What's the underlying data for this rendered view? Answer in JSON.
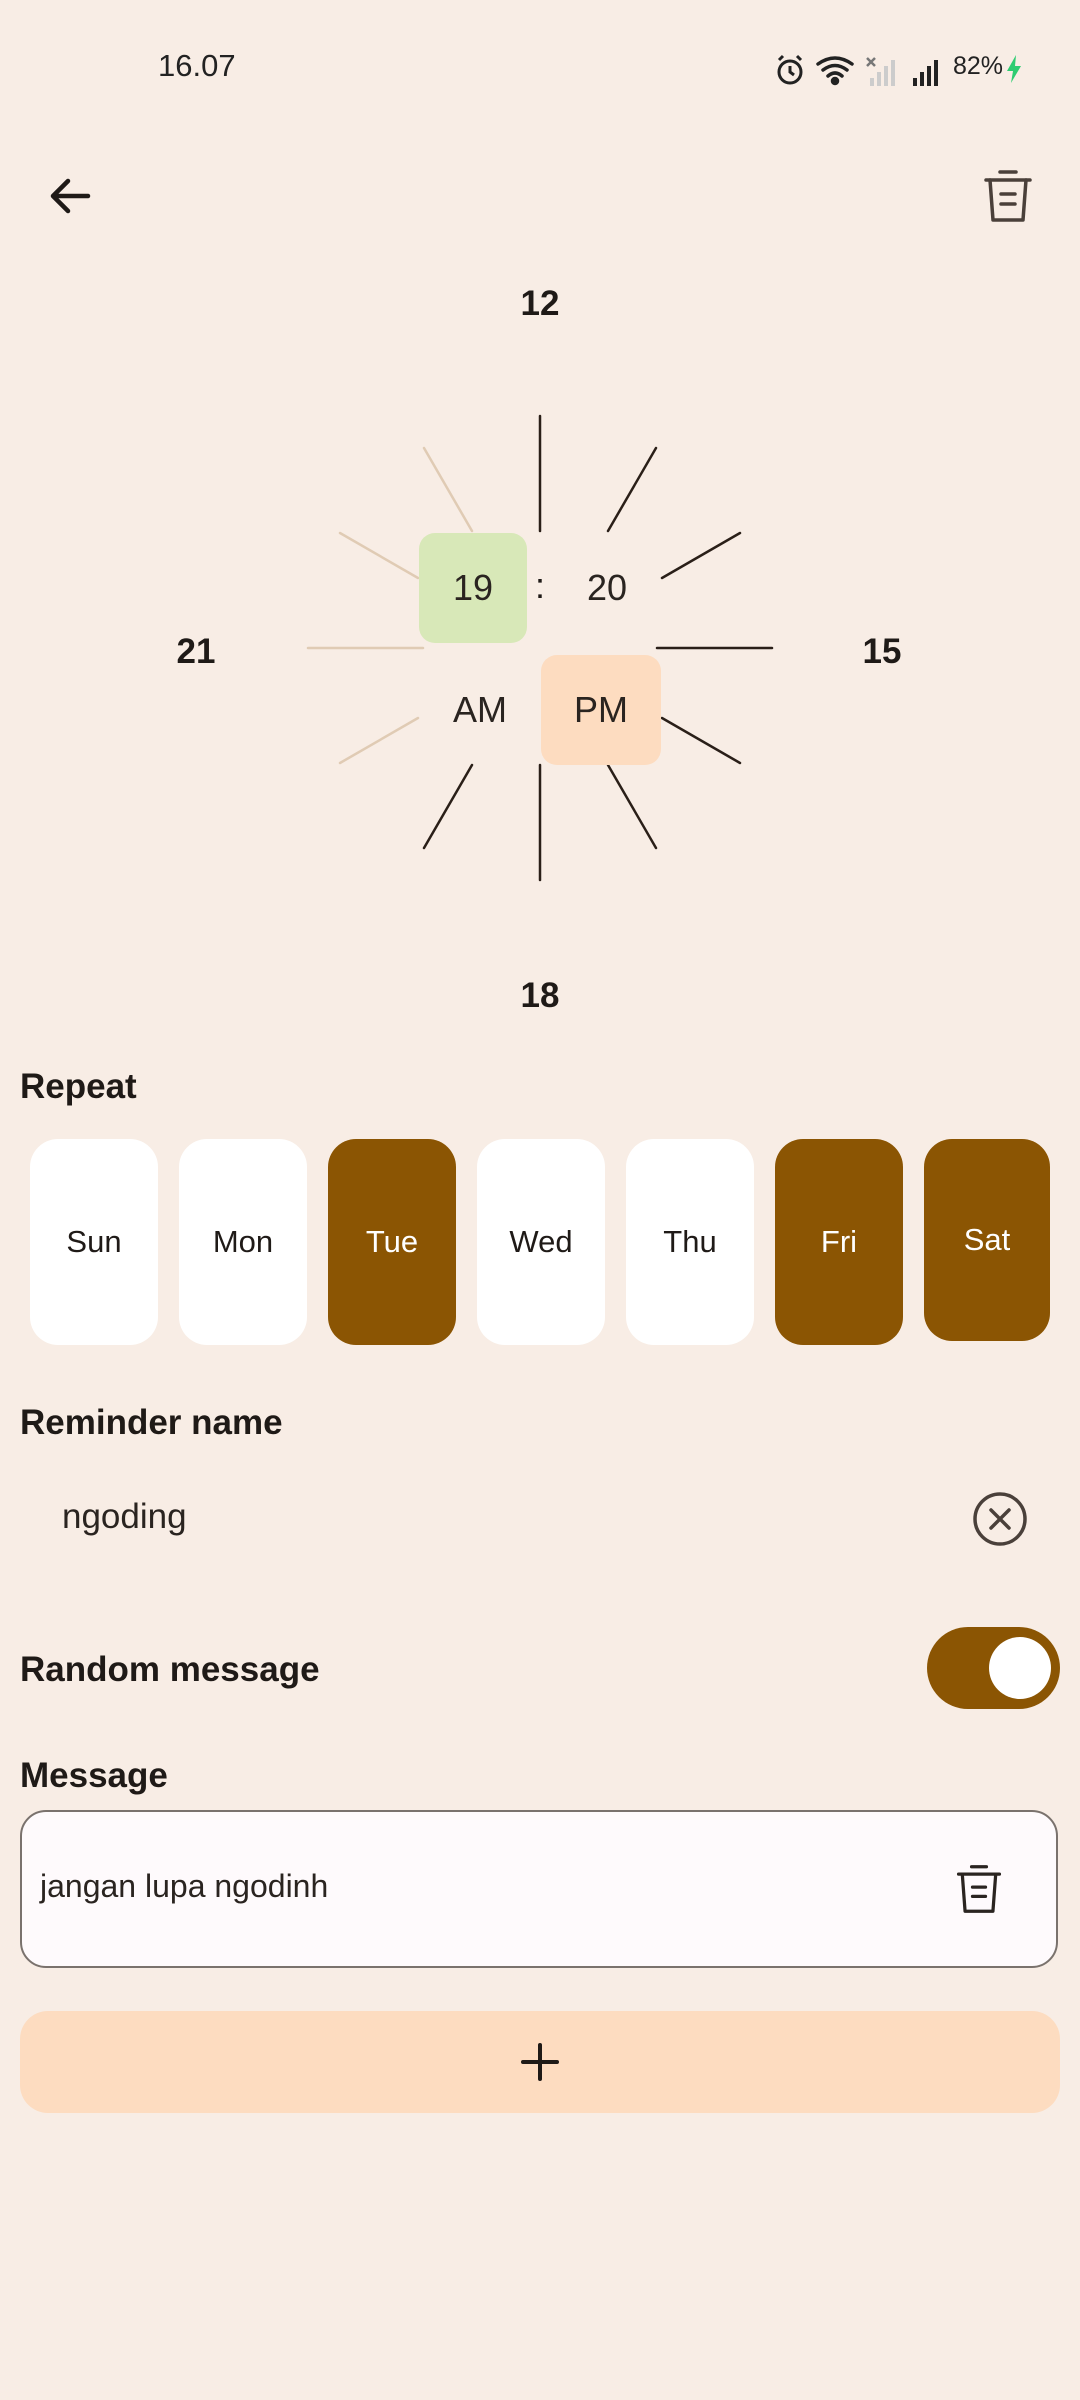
{
  "status_bar": {
    "time": "16.07",
    "battery": "82%",
    "icons": [
      "alarm-icon",
      "wifi-icon",
      "sim-no-signal-icon",
      "signal-icon",
      "charging-icon"
    ]
  },
  "top_bar": {
    "back_icon": "arrow-left-icon",
    "delete_icon": "trash-icon"
  },
  "clock": {
    "hour_labels": {
      "top": "12",
      "right": "15",
      "bottom": "18",
      "left": "21"
    },
    "hour": "19",
    "separator": ":",
    "minute": "20",
    "am": "AM",
    "pm": "PM",
    "selected_period": "PM"
  },
  "repeat": {
    "title": "Repeat",
    "days": [
      {
        "label": "Sun",
        "selected": false
      },
      {
        "label": "Mon",
        "selected": false
      },
      {
        "label": "Tue",
        "selected": true
      },
      {
        "label": "Wed",
        "selected": false
      },
      {
        "label": "Thu",
        "selected": false
      },
      {
        "label": "Fri",
        "selected": true
      },
      {
        "label": "Sat",
        "selected": true
      }
    ]
  },
  "reminder": {
    "title": "Reminder name",
    "value": "ngoding"
  },
  "random_message": {
    "title": "Random message",
    "enabled": true
  },
  "message": {
    "title": "Message",
    "items": [
      "jangan lupa ngodinh"
    ]
  },
  "add_button": {
    "icon": "plus-icon"
  },
  "colors": {
    "background": "#f8ede5",
    "accent": "#8b5503",
    "hour_highlight": "#d8e8b8",
    "period_highlight": "#fddcc0",
    "add_button": "#fddcc0"
  }
}
